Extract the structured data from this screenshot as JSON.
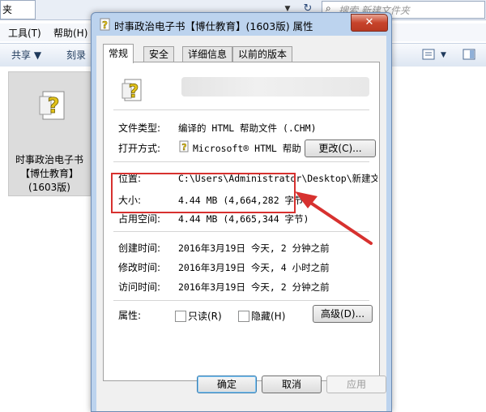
{
  "explorer": {
    "address_text": "夹",
    "search_placeholder": "搜索 新建文件夹",
    "menu": [
      "工具(T)",
      "帮助(H)"
    ],
    "toolbar": [
      "共享 ▼",
      "刻录"
    ],
    "file": {
      "name_line1": "时事政治电子书",
      "name_line2": "【博仕教育】",
      "name_line3": "(1603版)"
    }
  },
  "dialog": {
    "title": "时事政治电子书【博仕教育】(1603版) 属性",
    "close_label": "✕",
    "tabs": [
      "常规",
      "安全",
      "详细信息",
      "以前的版本"
    ],
    "general": {
      "file_type_label": "文件类型:",
      "file_type_value": "编译的 HTML 帮助文件 (.CHM)",
      "open_with_label": "打开方式:",
      "open_with_value": "Microsoft® HTML 帮助",
      "change_label": "更改(C)...",
      "location_label": "位置:",
      "location_value": "C:\\Users\\Administrator\\Desktop\\新建文件夹",
      "size_label": "大小:",
      "size_value": "4.44 MB (4,664,282 字节)",
      "size_on_disk_label": "占用空间:",
      "size_on_disk_value": "4.44 MB (4,665,344 字节)",
      "created_label": "创建时间:",
      "created_value": "2016年3月19日 今天, 2 分钟之前",
      "modified_label": "修改时间:",
      "modified_value": "2016年3月19日 今天, 4 小时之前",
      "accessed_label": "访问时间:",
      "accessed_value": "2016年3月19日 今天, 2 分钟之前",
      "attributes_label": "属性:",
      "readonly_label": "只读(R)",
      "hidden_label": "隐藏(H)",
      "advanced_label": "高级(D)..."
    },
    "buttons": {
      "ok": "确定",
      "cancel": "取消",
      "apply": "应用"
    }
  },
  "colors": {
    "highlight": "#d7312f",
    "title_bar": "#bcd3ee"
  }
}
